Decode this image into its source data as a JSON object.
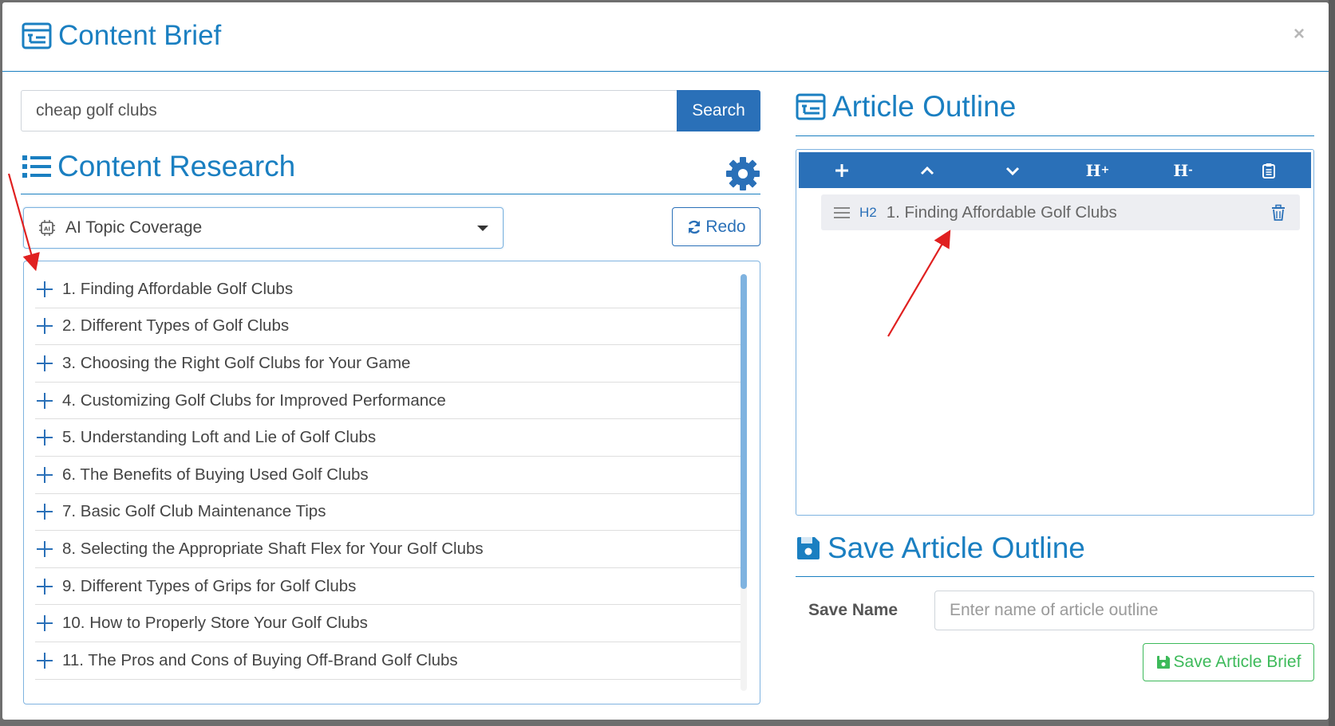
{
  "modal": {
    "title": "Content Brief",
    "close": "×"
  },
  "search": {
    "value": "cheap golf clubs",
    "button": "Search"
  },
  "research": {
    "title": "Content Research",
    "dropdown_value": "AI Topic Coverage",
    "redo_label": "Redo",
    "topics": [
      "1. Finding Affordable Golf Clubs",
      "2. Different Types of Golf Clubs",
      "3. Choosing the Right Golf Clubs for Your Game",
      "4. Customizing Golf Clubs for Improved Performance",
      "5. Understanding Loft and Lie of Golf Clubs",
      "6. The Benefits of Buying Used Golf Clubs",
      "7. Basic Golf Club Maintenance Tips",
      "8. Selecting the Appropriate Shaft Flex for Your Golf Clubs",
      "9. Different Types of Grips for Golf Clubs",
      "10. How to Properly Store Your Golf Clubs",
      "11. The Pros and Cons of Buying Off-Brand Golf Clubs"
    ]
  },
  "outline": {
    "title": "Article Outline",
    "toolbar": {
      "heading_up": "H",
      "heading_up_suffix": "+",
      "heading_down": "H",
      "heading_down_suffix": "-"
    },
    "items": [
      {
        "level": "H2",
        "text": "1. Finding Affordable Golf Clubs"
      }
    ]
  },
  "save": {
    "title": "Save Article Outline",
    "name_label": "Save Name",
    "name_placeholder": "Enter name of article outline",
    "button": "Save Article Brief"
  },
  "colors": {
    "accent": "#1a7fc1",
    "primary_button": "#2a70b8",
    "success": "#3dba5a",
    "annotation_arrow": "#e02020"
  }
}
